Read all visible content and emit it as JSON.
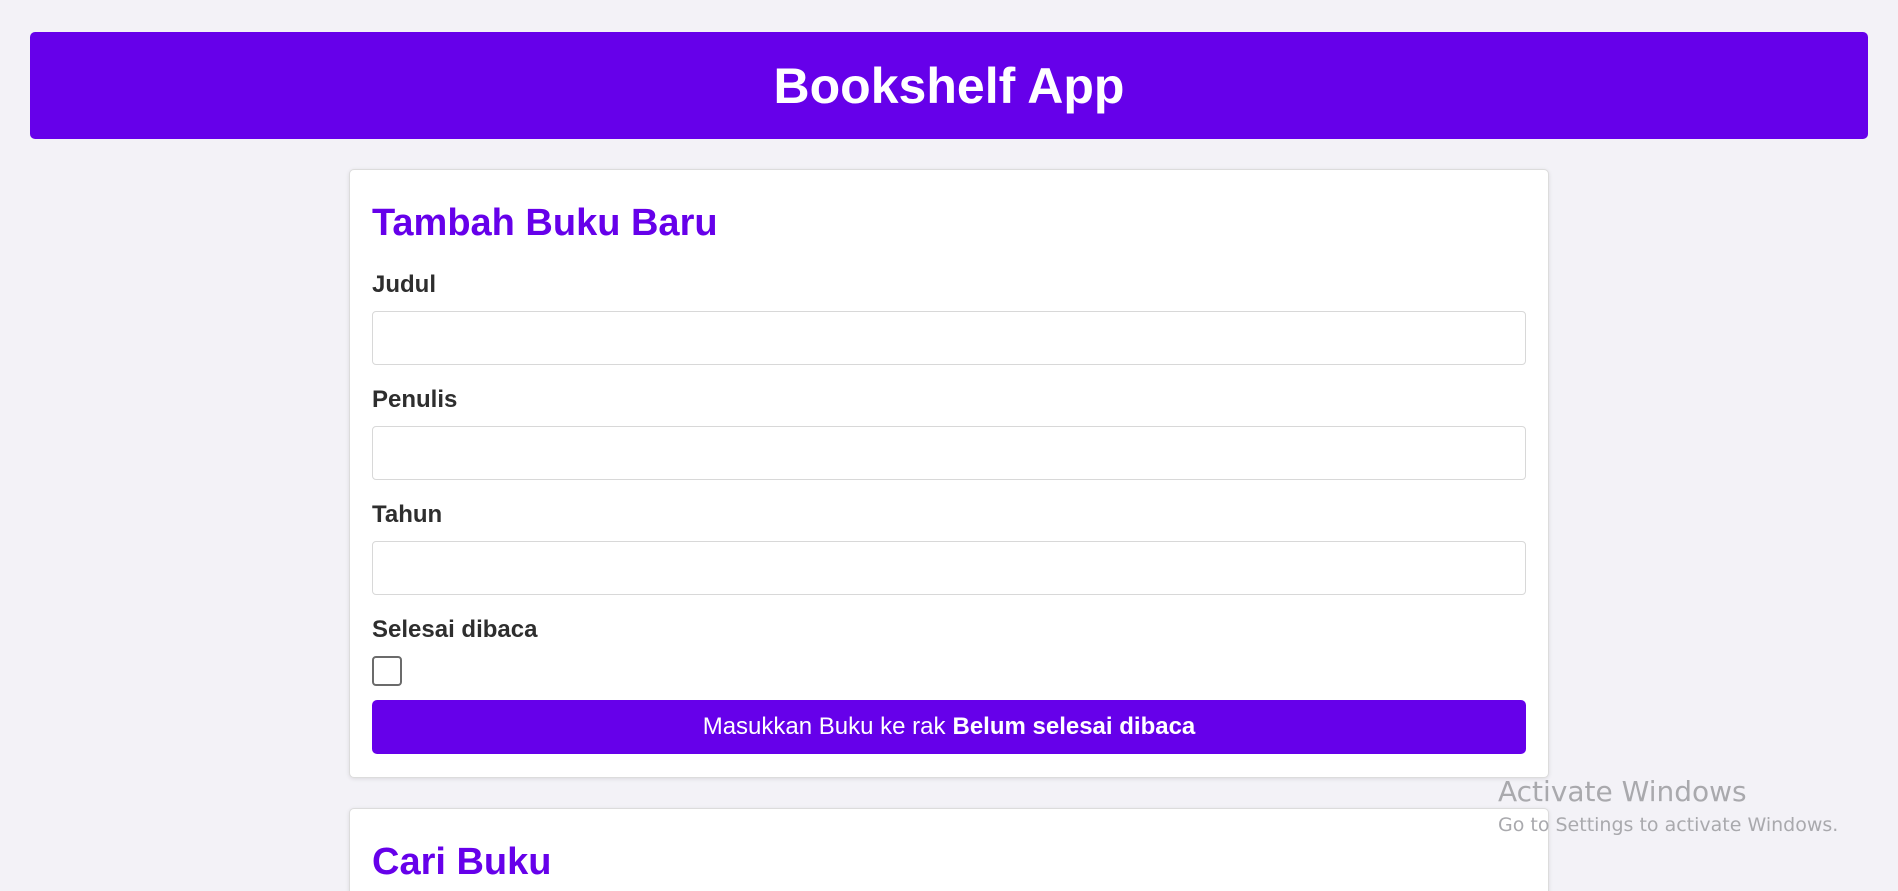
{
  "header": {
    "title": "Bookshelf App",
    "background_color": "#6600ea"
  },
  "add_form": {
    "title": "Tambah Buku Baru",
    "title_label": "Judul",
    "title_value": "",
    "author_label": "Penulis",
    "author_value": "",
    "year_label": "Tahun",
    "year_value": "",
    "complete_label": "Selesai dibaca",
    "complete_checked": false,
    "submit_prefix": "Masukkan Buku ke rak",
    "submit_shelf": "Belum selesai dibaca",
    "accent_color": "#6600ea"
  },
  "search": {
    "title": "Cari Buku"
  },
  "watermark": {
    "title": "Activate Windows",
    "subtitle": "Go to Settings to activate Windows."
  }
}
